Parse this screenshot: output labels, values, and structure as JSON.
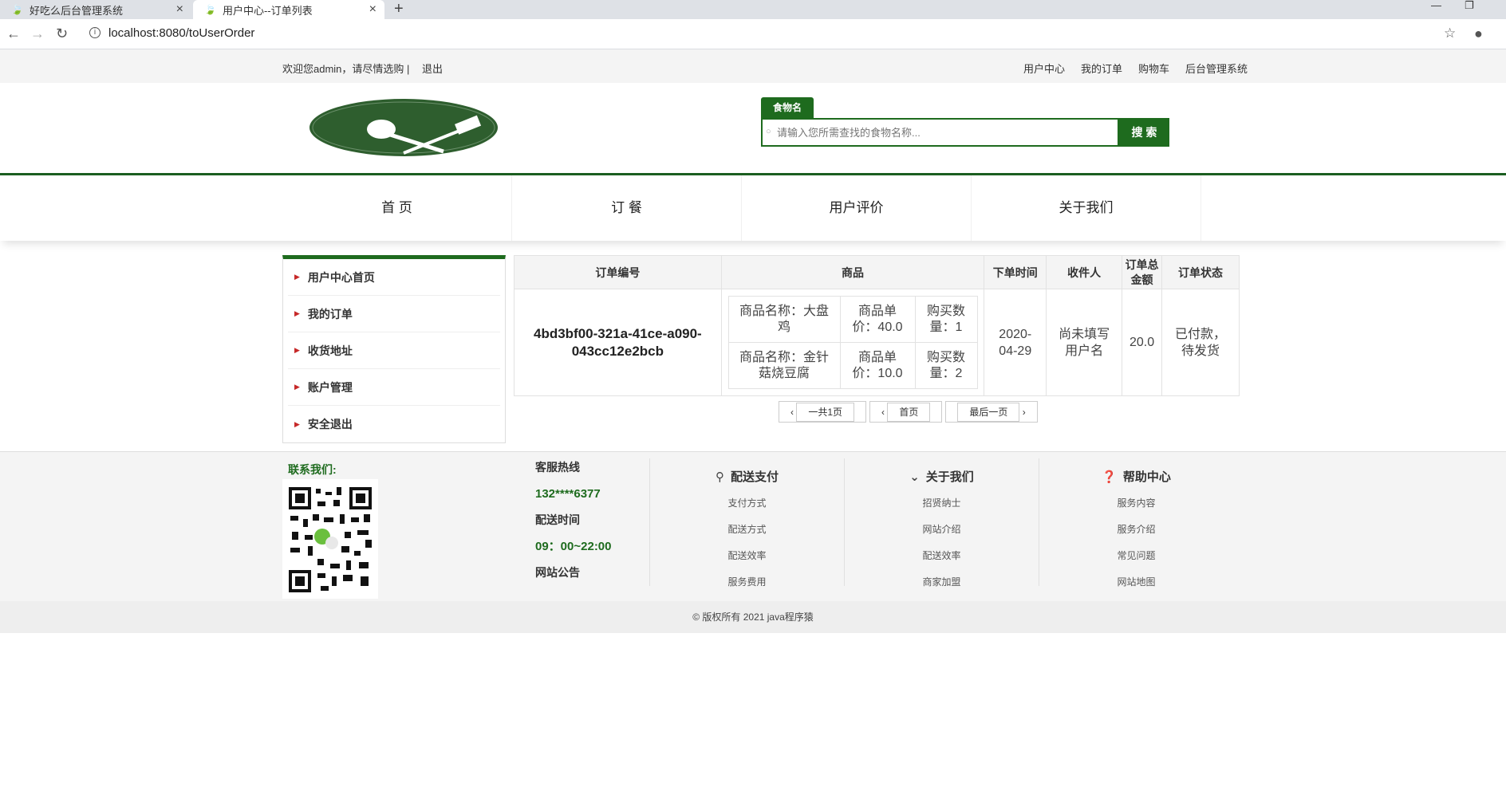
{
  "browser": {
    "tabs": [
      {
        "title": "好吃么后台管理系统"
      },
      {
        "title": "用户中心--订单列表"
      }
    ],
    "url": "localhost:8080/toUserOrder"
  },
  "topbar": {
    "welcome": "欢迎您admin，请尽情选购 |",
    "logout": "退出",
    "links": [
      "用户中心",
      "我的订单",
      "购物车",
      "后台管理系统"
    ]
  },
  "search": {
    "tab_label": "食物名",
    "placeholder": "请输入您所需查找的食物名称...",
    "button": "搜 索"
  },
  "nav": [
    "首 页",
    "订 餐",
    "用户评价",
    "关于我们"
  ],
  "sidebar": [
    "用户中心首页",
    "我的订单",
    "收货地址",
    "账户管理",
    "安全退出"
  ],
  "orders": {
    "headers": {
      "id": "订单编号",
      "goods": "商品",
      "time": "下单时间",
      "receiver": "收件人",
      "total": "订单总金额",
      "status": "订单状态"
    },
    "rows": [
      {
        "id": "4bd3bf00-321a-41ce-a090-043cc12e2bcb",
        "items": [
          {
            "name": "商品名称：大盘鸡",
            "price": "商品单价：40.0",
            "qty": "购买数量：1"
          },
          {
            "name": "商品名称：金针菇烧豆腐",
            "price": "商品单价：10.0",
            "qty": "购买数量：2"
          }
        ],
        "time": "2020-04-29",
        "receiver": "尚未填写用户名",
        "total": "20.0",
        "status": "已付款，待发货"
      }
    ],
    "pager": [
      "一共1页",
      "首页",
      "最后一页"
    ]
  },
  "footer": {
    "contact_title": "联系我们:",
    "hotline_label": "客服热线",
    "hotline": "132****6377",
    "hours_label": "配送时间",
    "hours": "09：00~22:00",
    "notice": "网站公告",
    "columns": [
      {
        "title": "配送支付",
        "icon": "bicycle-icon",
        "links": [
          "支付方式",
          "配送方式",
          "配送效率",
          "服务费用"
        ]
      },
      {
        "title": "关于我们",
        "icon": "chevron-down-icon",
        "links": [
          "招贤纳士",
          "网站介绍",
          "配送效率",
          "商家加盟"
        ]
      },
      {
        "title": "帮助中心",
        "icon": "question-circle-icon",
        "links": [
          "服务内容",
          "服务介绍",
          "常见问题",
          "网站地图"
        ]
      }
    ],
    "copyright": "© 版权所有 2021  java程序猿"
  },
  "colors": {
    "brand_green": "#1e6b1e",
    "accent_red": "#c62828"
  }
}
